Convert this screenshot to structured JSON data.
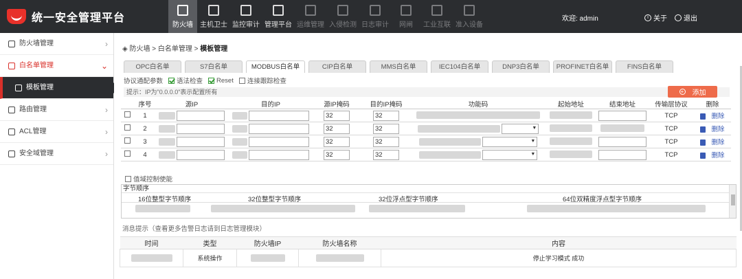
{
  "app": {
    "title": "统一安全管理平台",
    "brand_color": "#e8312a"
  },
  "nav": [
    {
      "label": "防火墙",
      "icon": "firewall-icon",
      "state": "active"
    },
    {
      "label": "主机卫士",
      "icon": "host-guard-icon",
      "state": "normal"
    },
    {
      "label": "监控审计",
      "icon": "monitor-audit-icon",
      "state": "normal"
    },
    {
      "label": "管理平台",
      "icon": "management-icon",
      "state": "normal"
    },
    {
      "label": "运维管理",
      "icon": "ops-icon",
      "state": "disabled"
    },
    {
      "label": "入侵检测",
      "icon": "intrusion-icon",
      "state": "disabled"
    },
    {
      "label": "日志审计",
      "icon": "log-audit-icon",
      "state": "disabled"
    },
    {
      "label": "网闸",
      "icon": "gateway-icon",
      "state": "disabled"
    },
    {
      "label": "工业互联",
      "icon": "industrial-icon",
      "state": "disabled"
    },
    {
      "label": "准入设备",
      "icon": "access-device-icon",
      "state": "disabled"
    }
  ],
  "user": {
    "welcome": "欢迎: admin",
    "about": "关于",
    "logout": "退出"
  },
  "sidebar": {
    "items": [
      {
        "label": "防火墙管理",
        "icon": "firewall-mgmt-icon"
      },
      {
        "label": "白名单管理",
        "icon": "whitelist-icon"
      },
      {
        "label": "模板管理",
        "icon": "template-icon"
      },
      {
        "label": "路由管理",
        "icon": "route-icon"
      },
      {
        "label": "ACL管理",
        "icon": "acl-icon"
      },
      {
        "label": "安全域管理",
        "icon": "security-domain-icon"
      }
    ]
  },
  "breadcrumb": {
    "part1": "防火墙 > 白名单管理 > ",
    "current": "模板管理"
  },
  "tabs": [
    "OPC白名单",
    "S7白名单",
    "MODBUS白名单",
    "CIP白名单",
    "MMS白名单",
    "IEC104白名单",
    "DNP3白名单",
    "PROFINET白名单",
    "FINS白名单"
  ],
  "active_tab": "MODBUS白名单",
  "options": {
    "label": "协议通配参数",
    "syntax": "语法检查",
    "reset": "Reset",
    "trace": "连接跟踪检查"
  },
  "hint": "提示：IP为\"0.0.0.0\"表示配置所有",
  "add_button": "添加",
  "rules_table": {
    "headers": [
      "序号",
      "源IP",
      "目的IP",
      "源IP掩码",
      "目的IP掩码",
      "功能码",
      "起始地址",
      "结束地址",
      "传输层协议",
      "删除"
    ],
    "rows": [
      {
        "no": "1",
        "src_mask": "32",
        "dst_mask": "32",
        "protocol": "TCP",
        "delete": "删除"
      },
      {
        "no": "2",
        "src_mask": "32",
        "dst_mask": "32",
        "protocol": "TCP",
        "delete": "删除"
      },
      {
        "no": "3",
        "src_mask": "32",
        "dst_mask": "32",
        "protocol": "TCP",
        "delete": "删除"
      },
      {
        "no": "4",
        "src_mask": "32",
        "dst_mask": "32",
        "protocol": "TCP",
        "delete": "删除"
      }
    ]
  },
  "domain_control": "值域控制使能",
  "byte_order": {
    "title": "字节顺序",
    "headers": [
      "16位整型字节顺序",
      "32位整型字节顺序",
      "32位浮点型字节顺序",
      "64位双精度浮点型字节顺序"
    ]
  },
  "messages": {
    "title": "消息提示（查看更多告警日志请到日志管理模块）",
    "headers": [
      "时间",
      "类型",
      "防火墙IP",
      "防火墙名称",
      "内容"
    ],
    "rows": [
      {
        "type": "系统操作",
        "content": "停止学习模式 成功"
      }
    ]
  }
}
